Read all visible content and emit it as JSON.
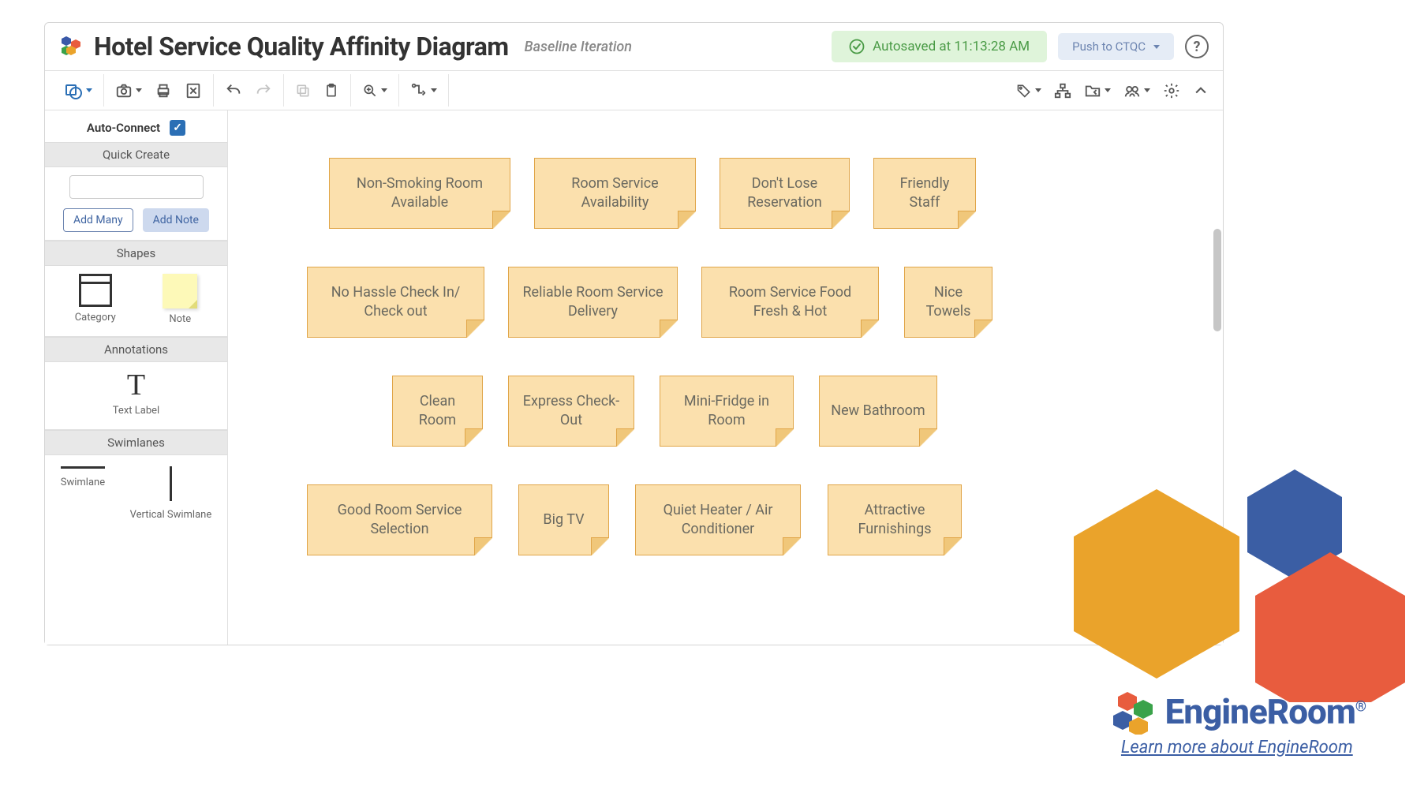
{
  "header": {
    "title": "Hotel Service Quality Affinity Diagram",
    "subtitle": "Baseline Iteration",
    "autosave": "Autosaved at 11:13:28 AM",
    "push_label": "Push to CTQC"
  },
  "sidebar": {
    "auto_connect_label": "Auto-Connect",
    "quick_create": {
      "title": "Quick Create",
      "add_many": "Add Many",
      "add_note": "Add Note"
    },
    "shapes": {
      "title": "Shapes",
      "category_label": "Category",
      "note_label": "Note"
    },
    "annotations": {
      "title": "Annotations",
      "text_label": "Text Label"
    },
    "swimlanes": {
      "title": "Swimlanes",
      "horizontal_label": "Swimlane",
      "vertical_label": "Vertical Swimlane"
    }
  },
  "notes": {
    "r1c1": "Non-Smoking Room Available",
    "r1c2": "Room Service Availability",
    "r1c3": "Don't Lose Reservation",
    "r1c4": "Friendly Staff",
    "r2c1": "No Hassle Check In/ Check out",
    "r2c2": "Reliable Room Service Delivery",
    "r2c3": "Room Service Food Fresh & Hot",
    "r2c4": "Nice Towels",
    "r3c1": "Clean Room",
    "r3c2": "Express Check-Out",
    "r3c3": "Mini-Fridge in Room",
    "r3c4": "New Bathroom",
    "r4c1": "Good Room Service Selection",
    "r4c2": "Big TV",
    "r4c3": "Quiet Heater / Air Conditioner",
    "r4c4": "Attractive Furnishings"
  },
  "branding": {
    "name": "EngineRoom",
    "learn_more": "Learn more about EngineRoom"
  }
}
